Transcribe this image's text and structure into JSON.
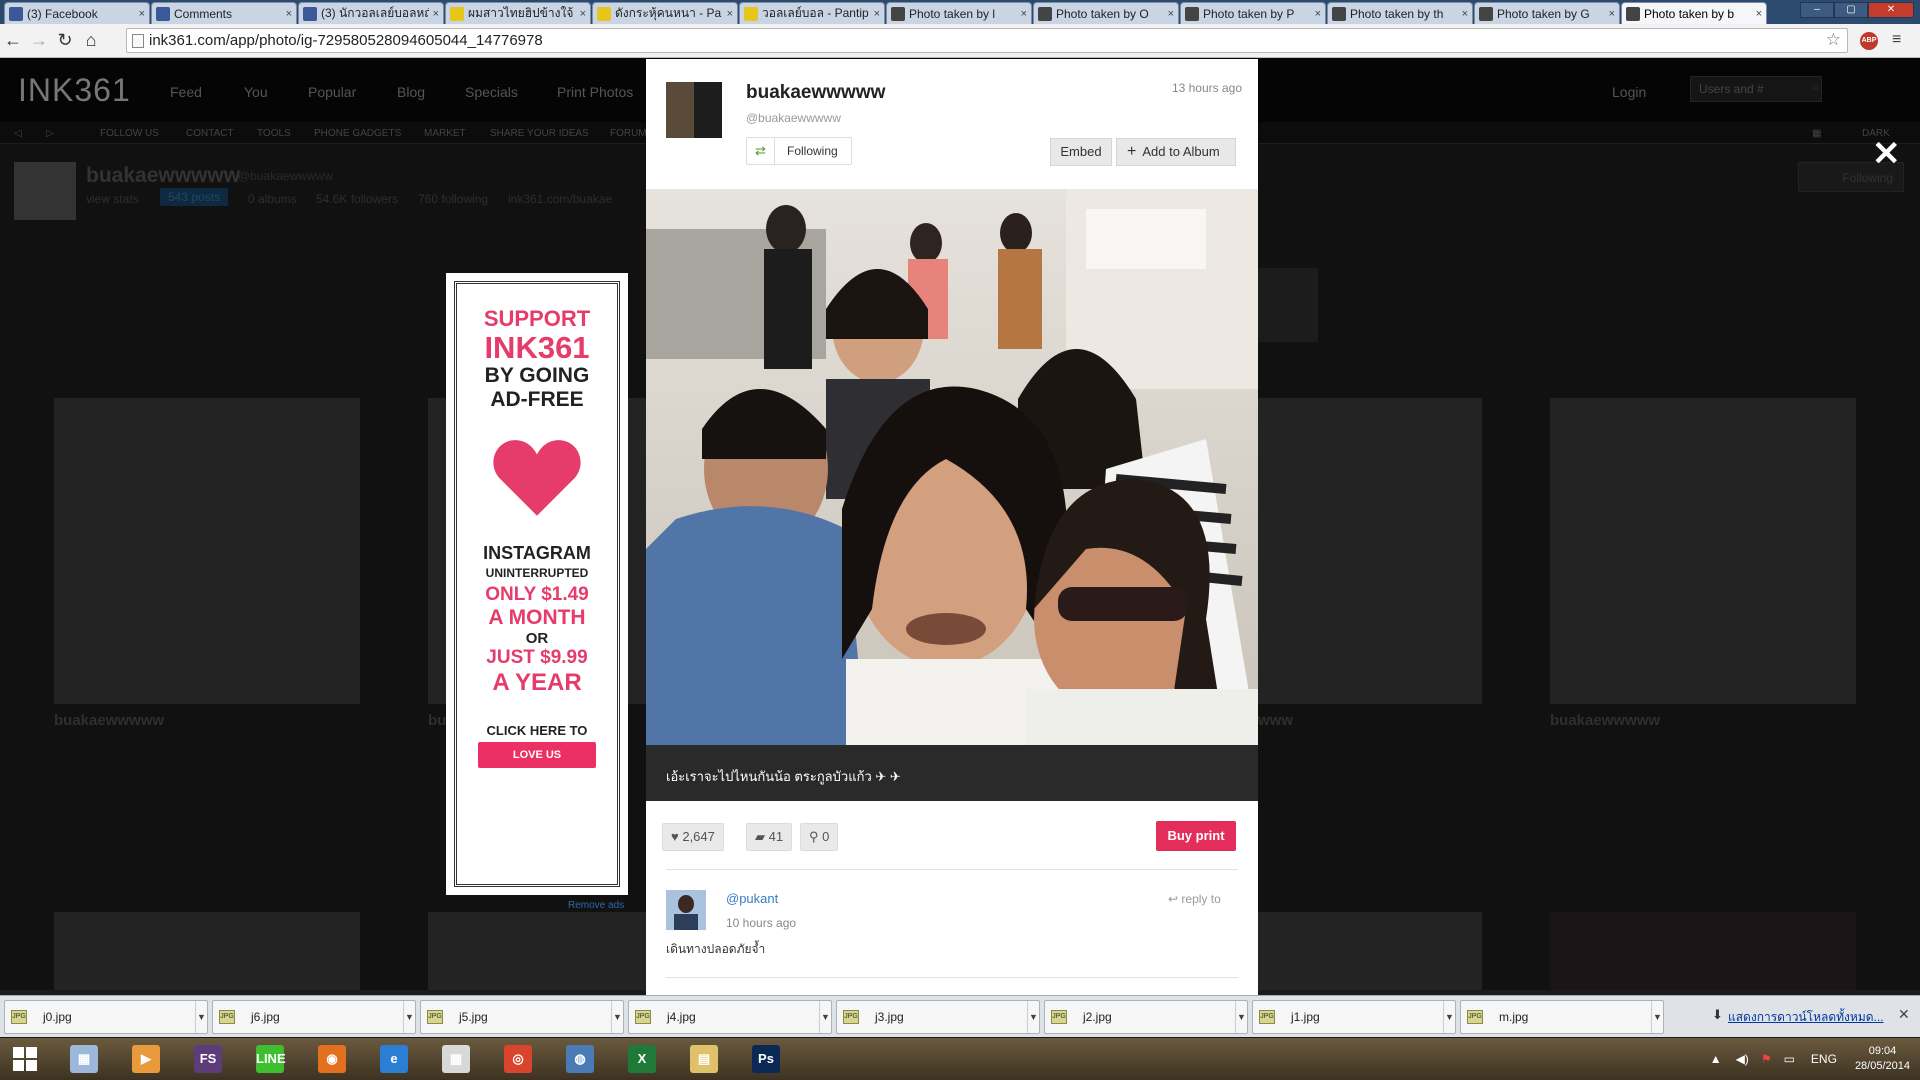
{
  "browser": {
    "tabs": [
      {
        "title": "(3) Facebook",
        "favicon": "facebook-icon",
        "color": "#3b5998"
      },
      {
        "title": "Comments",
        "favicon": "facebook-icon",
        "color": "#3b5998"
      },
      {
        "title": "(3) นักวอลเลย์บอลหญิง",
        "favicon": "facebook-icon",
        "color": "#3b5998"
      },
      {
        "title": "ผมสาวไทยฮิปข้างใจ้",
        "favicon": "pantip-icon",
        "color": "#e6c619"
      },
      {
        "title": "ดังกระหุ้คนหนา - Pa",
        "favicon": "pantip-icon",
        "color": "#e6c619"
      },
      {
        "title": "วอลเลย์บอล - Pantip",
        "favicon": "pantip-icon",
        "color": "#e6c619"
      },
      {
        "title": "Photo taken by l",
        "favicon": "ink361-icon",
        "color": "#444444"
      },
      {
        "title": "Photo taken by O",
        "favicon": "ink361-icon",
        "color": "#444444"
      },
      {
        "title": "Photo taken by P",
        "favicon": "ink361-icon",
        "color": "#444444"
      },
      {
        "title": "Photo taken by th",
        "favicon": "ink361-icon",
        "color": "#444444"
      },
      {
        "title": "Photo taken by G",
        "favicon": "ink361-icon",
        "color": "#444444"
      },
      {
        "title": "Photo taken by b",
        "favicon": "ink361-icon",
        "color": "#444444",
        "active": true
      }
    ],
    "tab_close": "×",
    "url": "ink361.com/app/photo/ig-729580528094605044_14776978",
    "abp": "ABP",
    "nav": {
      "back": "←",
      "forward": "→",
      "reload": "↻",
      "home": "⌂",
      "star": "☆",
      "menu": "≡"
    }
  },
  "site": {
    "logo": "INK361",
    "nav": [
      "Feed",
      "You",
      "Popular",
      "Blog",
      "Specials",
      "Print Photos"
    ],
    "login": "Login",
    "search_placeholder": "Users and #",
    "subnav": [
      "FOLLOW US",
      "CONTACT",
      "TOOLS",
      "PHONE GADGETS",
      "MARKET",
      "SHARE YOUR IDEAS",
      "FORUM"
    ],
    "dark_label": "DARK",
    "profile": {
      "name": "buakaewwwww",
      "handle": "@buakaewwwww",
      "view_stats": "view stats",
      "posts": "543 posts",
      "albums": "0 albums",
      "followers": "54.6K followers",
      "following": "760 following",
      "link": "ink361.com/buakae",
      "follow_button": "Following"
    },
    "grid_names": [
      "buakaewwwww",
      "bu",
      "www",
      "buakaewwwww"
    ],
    "close_overlay": "✕"
  },
  "ad": {
    "line1": "SUPPORT",
    "line2": "INK361",
    "line3": "BY GOING",
    "line4": "AD-FREE",
    "line5": "INSTAGRAM",
    "line6": "UNINTERRUPTED",
    "line7": "ONLY $1.49",
    "line8": "A MONTH",
    "line9": "OR",
    "line10": "JUST $9.99",
    "line11": "A YEAR",
    "cta": "CLICK HERE TO",
    "button": "LOVE US",
    "remove_ads": "Remove ads",
    "heart_color": "#e63c6b"
  },
  "photo_modal": {
    "username": "buakaewwwww",
    "handle": "@buakaewwwww",
    "time": "13 hours ago",
    "follow_label": "Following",
    "embed_label": "Embed",
    "add_album_label": "Add to Album",
    "add_icon": "+",
    "caption": "เอ้ะเราจะไปไหนกันน้อ ตระกูลบัวแก้ว ✈ ✈",
    "likes": "2,647",
    "comments": "41",
    "people": "0",
    "buy_print": "Buy print",
    "comment": {
      "user": "@pukant",
      "time": "10 hours ago",
      "reply": "reply to",
      "text": "เดินทางปลอดภัยจ้ำ"
    }
  },
  "downloads": {
    "items": [
      "j0.jpg",
      "j6.jpg",
      "j5.jpg",
      "j4.jpg",
      "j3.jpg",
      "j2.jpg",
      "j1.jpg",
      "m.jpg"
    ],
    "file_badge": "JPG",
    "show_all": "แสดงการดาวน์โหลดทั้งหมด...",
    "close": "✕"
  },
  "taskbar": {
    "apps": [
      {
        "name": "calculator-icon",
        "label": "▦",
        "color": "#9bb7d9"
      },
      {
        "name": "media-player-icon",
        "label": "▶",
        "color": "#e89a3c"
      },
      {
        "name": "fs-icon",
        "label": "FS",
        "color": "#5c3d7a"
      },
      {
        "name": "line-icon",
        "label": "LINE",
        "color": "#3fbf2f"
      },
      {
        "name": "firefox-icon",
        "label": "◉",
        "color": "#e2701e"
      },
      {
        "name": "ie-icon",
        "label": "e",
        "color": "#2a7fd4"
      },
      {
        "name": "apps-icon",
        "label": "▦",
        "color": "#d8d8d8"
      },
      {
        "name": "chrome-icon",
        "label": "◎",
        "color": "#d9442c"
      },
      {
        "name": "network-icon",
        "label": "◍",
        "color": "#4b7bb5"
      },
      {
        "name": "excel-icon",
        "label": "X",
        "color": "#1f7a3a"
      },
      {
        "name": "explorer-icon",
        "label": "▤",
        "color": "#e0c06a"
      },
      {
        "name": "photoshop-icon",
        "label": "Ps",
        "color": "#0a2a55"
      }
    ],
    "lang": "ENG",
    "time": "09:04",
    "date": "28/05/2014"
  }
}
